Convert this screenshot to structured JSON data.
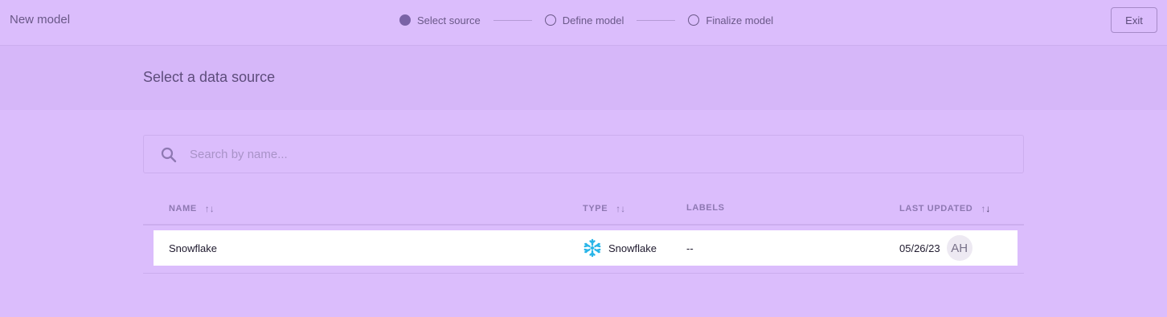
{
  "app": {
    "title": "New model"
  },
  "steps": [
    {
      "label": "Select source",
      "state": "active"
    },
    {
      "label": "Define model",
      "state": "pending"
    },
    {
      "label": "Finalize model",
      "state": "pending"
    }
  ],
  "exit_label": "Exit",
  "section": {
    "title": "Select a data source"
  },
  "search": {
    "placeholder": "Search by name...",
    "value": "",
    "icon": "search-icon"
  },
  "table": {
    "columns": {
      "name": "NAME",
      "type": "TYPE",
      "labels": "LABELS",
      "last_updated": "LAST UPDATED"
    },
    "sort_glyph": "↑↓",
    "sort_up": "↑",
    "sort_down_active": "↓",
    "rows": [
      {
        "name": "Snowflake",
        "type": "Snowflake",
        "type_icon": "snowflake-icon",
        "labels": "--",
        "last_updated": "05/26/23",
        "avatar_initials": "AH"
      }
    ]
  },
  "colors": {
    "background": "#dbbdfc",
    "header_band": "#d6b7f9",
    "snowflake_brand": "#29b5e8",
    "row_background": "#ffffff"
  }
}
